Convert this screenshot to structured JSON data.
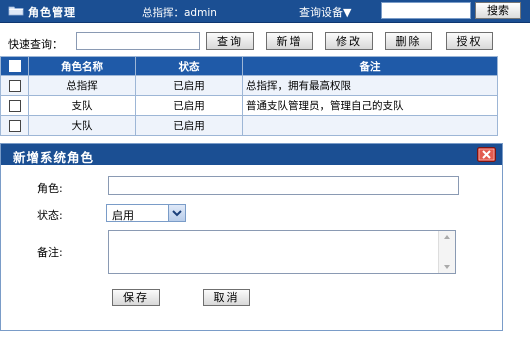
{
  "header": {
    "title": "角色管理",
    "user": "总指挥：admin",
    "device_menu": "查询设备▼",
    "search_placeholder": "",
    "search_button": "搜索"
  },
  "toolbar": {
    "quick_query_label": "快速查询：",
    "query_value": "",
    "buttons": [
      "查询",
      "新增",
      "修改",
      "删除",
      "授权"
    ]
  },
  "table": {
    "columns": [
      "角色名称",
      "状态",
      "备注"
    ],
    "rows": [
      {
        "name": "总指挥",
        "status": "已启用",
        "note": "总指挥，拥有最高权限"
      },
      {
        "name": "支队",
        "status": "已启用",
        "note": "普通支队管理员，管理自己的支队"
      },
      {
        "name": "大队",
        "status": "已启用",
        "note": ""
      }
    ]
  },
  "dialog": {
    "title": "新增系统角色",
    "role_label": "角色:",
    "role_value": "",
    "status_label": "状态:",
    "status_value": "启用",
    "remark_label": "备注:",
    "save_label": "保存",
    "cancel_label": "取消"
  },
  "colors": {
    "header_bg": "#1b4f93",
    "table_header_bg": "#1f5aa8",
    "close_red": "#c0302a"
  }
}
